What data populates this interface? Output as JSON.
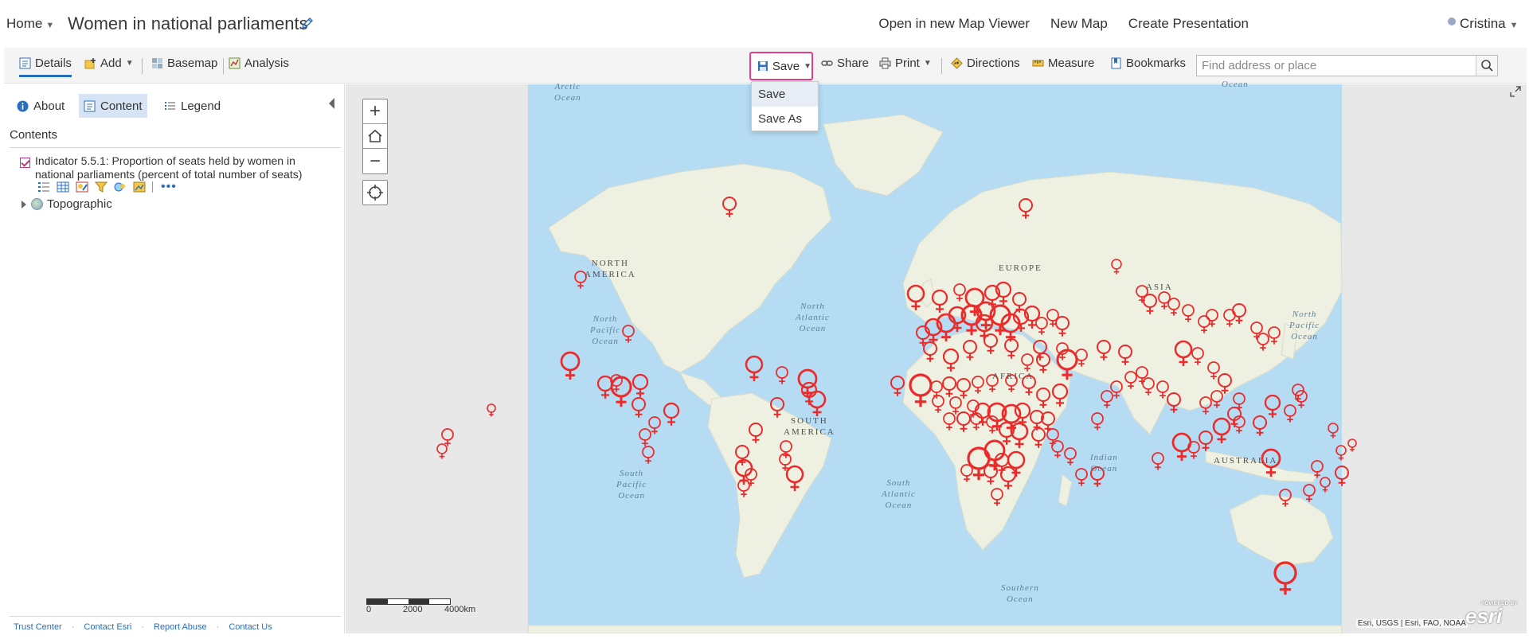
{
  "header": {
    "home_label": "Home",
    "map_title": "Women in national parliaments",
    "links": [
      "Open in new Map Viewer",
      "New Map",
      "Create Presentation"
    ],
    "user_name": "Cristina"
  },
  "toolbar": {
    "details_label": "Details",
    "add_label": "Add",
    "basemap_label": "Basemap",
    "analysis_label": "Analysis",
    "save_label": "Save",
    "share_label": "Share",
    "print_label": "Print",
    "directions_label": "Directions",
    "measure_label": "Measure",
    "bookmarks_label": "Bookmarks",
    "search_placeholder": "Find address or place"
  },
  "save_menu": {
    "items": [
      "Save",
      "Save As"
    ],
    "highlighted_index": 0
  },
  "panel": {
    "tabs": [
      {
        "label": "About",
        "icon": "info-icon"
      },
      {
        "label": "Content",
        "icon": "content-icon"
      },
      {
        "label": "Legend",
        "icon": "legend-icon"
      }
    ],
    "active_tab": "Content",
    "contents_heading": "Contents",
    "layer": {
      "name": "Indicator 5.5.1: Proportion of seats held by women in national parliaments (percent of total number of seats)",
      "checked": true
    },
    "basemap_layer": "Topographic",
    "footer_links": [
      "Trust Center",
      "Contact Esri",
      "Report Abuse",
      "Contact Us"
    ]
  },
  "map": {
    "labels": {
      "arctic": "Arctic\nOcean",
      "north_america": "NORTH\nAMERICA",
      "north_pacific": "North\nPacific\nOcean",
      "north_atlantic": "North\nAtlantic\nOcean",
      "south_pacific": "South\nPacific\nOcean",
      "south_america": "SOUTH\nAMERICA",
      "south_atlantic": "South\nAtlantic\nOcean",
      "europe": "EUROPE",
      "africa": "AFRICA",
      "asia": "ASIA",
      "north_pacific_east": "North\nPacific\nOcean",
      "indian": "Indian\nOcean",
      "australia": "AUSTRALIA",
      "southern": "Southern\nOcean",
      "top_ocean": "Ocean"
    },
    "scale_labels": [
      "0",
      "2000",
      "4000km"
    ],
    "attribution": "Esri, USGS | Esri, FAO, NOAA",
    "logo_small": "POWERED BY",
    "logo_text": "esri",
    "symbol_color": "#ec2a2a",
    "water_color": "#b5dcf3",
    "land_color": "#eef0e2"
  }
}
